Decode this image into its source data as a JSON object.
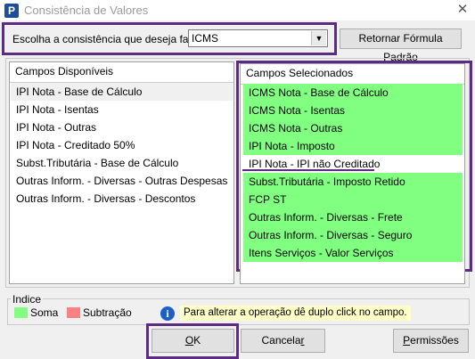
{
  "window": {
    "app_icon_letter": "P",
    "title": "Consistência de Valores",
    "close_glyph": "✕"
  },
  "selector": {
    "label": "Escolha a consistência que deseja fazer:",
    "value": "ICMS",
    "dropdown_glyph": "▼"
  },
  "buttons": {
    "retornar": "Retornar Fórmula Padrão",
    "ok_key": "O",
    "ok_rest": "K",
    "cancelar_pre": "Cancela",
    "cancelar_key": "r",
    "permissoes_key": "P",
    "permissoes_rest": "ermissões"
  },
  "available": {
    "header": "Campos Disponíveis",
    "items": [
      "IPI Nota - Base de Cálculo",
      "IPI Nota - Isentas",
      "IPI Nota - Outras",
      "IPI Nota - Creditado 50%",
      "Subst.Tributária - Base de Cálculo",
      "Outras Inform. - Diversas - Outras Despesas",
      "Outras Inform. - Diversas - Descontos"
    ]
  },
  "selected": {
    "header": "Campos Selecionados",
    "items": [
      {
        "label": "ICMS Nota - Base de Cálculo",
        "operation": "soma"
      },
      {
        "label": "ICMS Nota - Isentas",
        "operation": "soma"
      },
      {
        "label": "ICMS Nota - Outras",
        "operation": "soma"
      },
      {
        "label": "IPI Nota - Imposto",
        "operation": "soma"
      },
      {
        "label": "IPI Nota - IPI não Creditado",
        "operation": "none"
      },
      {
        "label": "Subst.Tributária - Imposto Retido",
        "operation": "soma"
      },
      {
        "label": "FCP ST",
        "operation": "soma"
      },
      {
        "label": "Outras Inform. - Diversas - Frete",
        "operation": "soma"
      },
      {
        "label": "Outras Inform. - Diversas - Seguro",
        "operation": "soma"
      },
      {
        "label": "Itens Serviços - Valor Serviços",
        "operation": "soma"
      }
    ]
  },
  "legend": {
    "title": "Indice",
    "soma": "Soma",
    "subtracao": "Subtração",
    "info_glyph": "i",
    "note": "Para alterar a operação dê duplo click no campo."
  },
  "colors": {
    "soma": "#80ff80",
    "subtracao": "#ff8080",
    "highlight": "#5b2c82",
    "note_bg": "#ffffc8"
  }
}
